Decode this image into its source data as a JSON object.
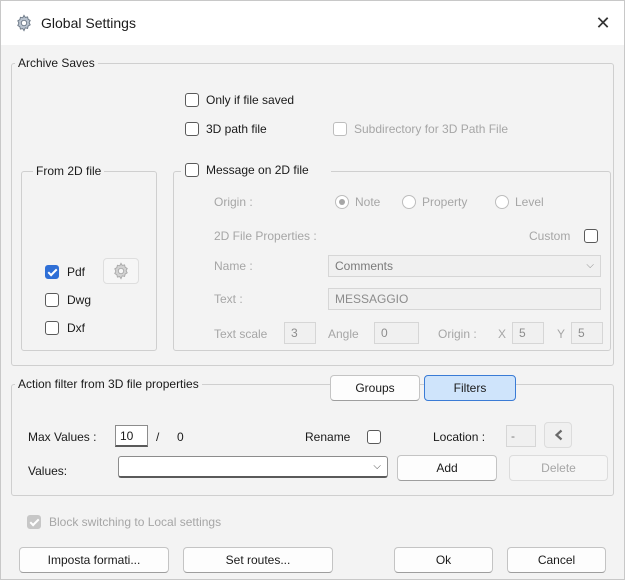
{
  "window": {
    "title": "Global Settings",
    "close": "✕"
  },
  "archive": {
    "legend": "Archive Saves",
    "only_if_saved": "Only if file saved",
    "path_3d_file": "3D path file",
    "subdir_3d": "Subdirectory for 3D Path File"
  },
  "from2d": {
    "legend": "From 2D file",
    "items": [
      {
        "label": "Pdf",
        "checked": true
      },
      {
        "label": "Dwg",
        "checked": false
      },
      {
        "label": "Dxf",
        "checked": false
      }
    ]
  },
  "message": {
    "checkbox_label": "Message on 2D file",
    "origin_label": "Origin :",
    "origin_options": [
      "Note",
      "Property",
      "Level"
    ],
    "origin_selected": "Note",
    "props_label": "2D File Properties :",
    "custom_label": "Custom",
    "name_label": "Name :",
    "name_value": "Comments",
    "text_label": "Text :",
    "text_value": "MESSAGGIO",
    "text_scale_label": "Text scale",
    "text_scale_value": "3",
    "angle_label": "Angle",
    "angle_value": "0",
    "origin2_label": "Origin :",
    "x_label": "X",
    "x_value": "5",
    "y_label": "Y",
    "y_value": "5"
  },
  "filter": {
    "legend": "Action filter from 3D file properties",
    "groups_btn": "Groups",
    "filters_btn": "Filters",
    "max_values_label": "Max Values :",
    "max_values_value": "10",
    "slash": "/",
    "max_total": "0",
    "rename_label": "Rename",
    "location_label": "Location :",
    "location_value": "-",
    "values_label": "Values:",
    "add_btn": "Add",
    "delete_btn": "Delete"
  },
  "block_switch_label": "Block switching to Local settings",
  "buttons": {
    "imposta": "Imposta formati...",
    "routes": "Set routes...",
    "ok": "Ok",
    "cancel": "Cancel"
  },
  "colors": {
    "accent": "#2f6fd6",
    "active_btn": "#cfe4fb",
    "background": "#f3f3f3"
  }
}
